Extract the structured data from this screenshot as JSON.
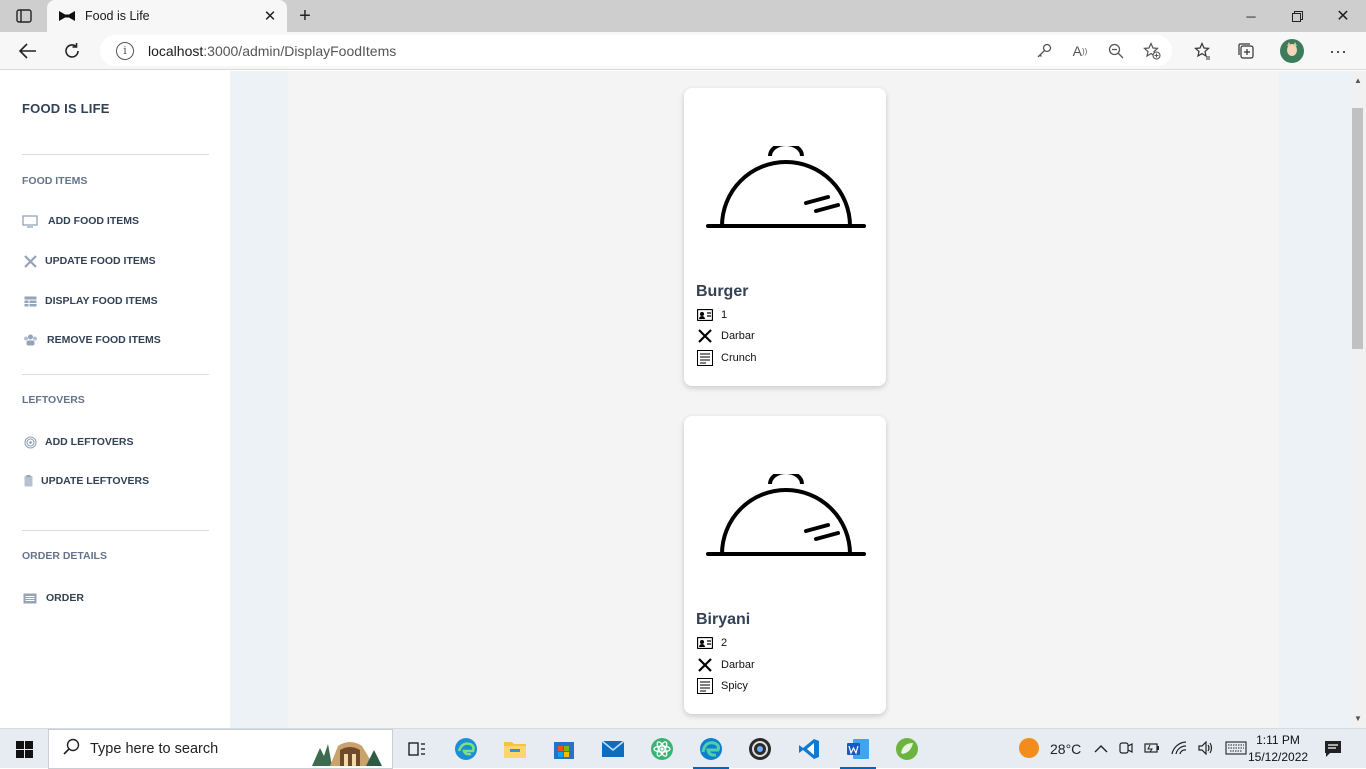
{
  "browser": {
    "tab_title": "Food is Life",
    "url_host": "localhost",
    "url_path": ":3000/admin/DisplayFoodItems"
  },
  "sidebar": {
    "brand": "FOOD IS LIFE",
    "sections": [
      {
        "heading": "FOOD ITEMS",
        "items": [
          {
            "label": "ADD FOOD ITEMS",
            "icon": "monitor-icon"
          },
          {
            "label": "UPDATE FOOD ITEMS",
            "icon": "tools-icon"
          },
          {
            "label": "DISPLAY FOOD ITEMS",
            "icon": "table-icon"
          },
          {
            "label": "REMOVE FOOD ITEMS",
            "icon": "users-icon"
          }
        ]
      },
      {
        "heading": "LEFTOVERS",
        "items": [
          {
            "label": "ADD LEFTOVERS",
            "icon": "fingerprint-icon"
          },
          {
            "label": "UPDATE LEFTOVERS",
            "icon": "clipboard-icon"
          }
        ]
      },
      {
        "heading": "ORDER DETAILS",
        "items": [
          {
            "label": "ORDER",
            "icon": "list-icon"
          }
        ]
      }
    ]
  },
  "food_items": [
    {
      "name": "Burger",
      "id": "1",
      "restaurant": "Darbar",
      "description": "Crunch"
    },
    {
      "name": "Biryani",
      "id": "2",
      "restaurant": "Darbar",
      "description": "Spicy"
    }
  ],
  "taskbar": {
    "search_placeholder": "Type here to search",
    "temperature": "28°C",
    "time": "1:11 PM",
    "date": "15/12/2022"
  }
}
